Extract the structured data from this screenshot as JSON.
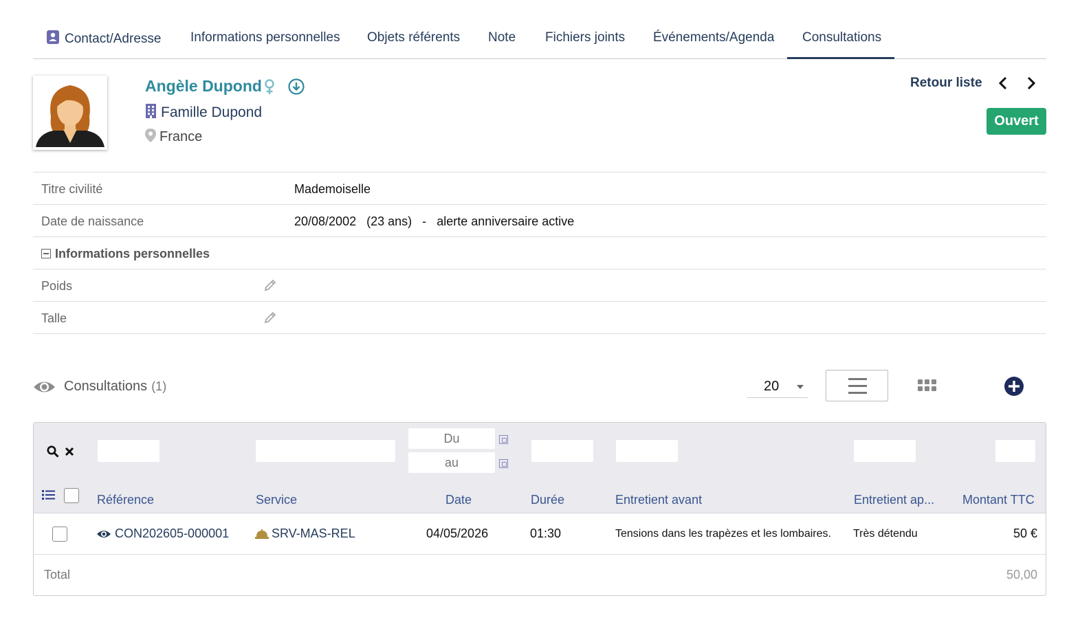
{
  "tabs": [
    {
      "label": "Contact/Adresse",
      "icon": "contact-card-icon"
    },
    {
      "label": "Informations personnelles"
    },
    {
      "label": "Objets référents"
    },
    {
      "label": "Note"
    },
    {
      "label": "Fichiers joints"
    },
    {
      "label": "Événements/Agenda"
    },
    {
      "label": "Consultations",
      "active": true
    }
  ],
  "contact": {
    "name": "Angèle Dupond",
    "family": "Famille Dupond",
    "country": "France"
  },
  "header": {
    "back_label": "Retour liste",
    "status": "Ouvert",
    "status_color": "#25a570"
  },
  "fields": {
    "civility": {
      "label": "Titre civilité",
      "value": "Mademoiselle"
    },
    "birth": {
      "label": "Date de naissance",
      "date": "20/08/2002",
      "age": "(23 ans)",
      "sep": "-",
      "alert": "alerte anniversaire active"
    },
    "section": "Informations personnelles",
    "weight": {
      "label": "Poids"
    },
    "height": {
      "label": "Talle"
    }
  },
  "consultations": {
    "title": "Consultations",
    "count": "(1)",
    "limit": "20",
    "date_from": "Du",
    "date_to": "au",
    "columns": {
      "reference": "Référence",
      "service": "Service",
      "date": "Date",
      "duration": "Durée",
      "before": "Entretient avant",
      "after": "Entretient ap...",
      "amount": "Montant TTC"
    },
    "rows": [
      {
        "reference": "CON202605-000001",
        "service": "SRV-MAS-REL",
        "date": "04/05/2026",
        "duration": "01:30",
        "before": "Tensions dans les trapèzes et les lombaires.",
        "after": "Très détendu",
        "amount": "50 €"
      }
    ],
    "total_label": "Total",
    "total_value": "50,00"
  }
}
